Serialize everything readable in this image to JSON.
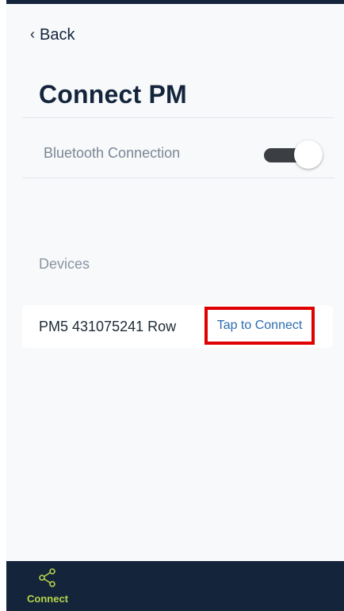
{
  "header": {
    "back_label": "Back",
    "title": "Connect PM"
  },
  "bluetooth": {
    "label": "Bluetooth Connection",
    "enabled": true
  },
  "devices": {
    "section_label": "Devices",
    "items": [
      {
        "name": "PM5 431075241 Row",
        "action_label": "Tap to Connect"
      }
    ]
  },
  "tabbar": {
    "tabs": [
      {
        "label": "Connect",
        "icon": "share-nodes-icon",
        "active": true
      }
    ]
  },
  "colors": {
    "navy": "#13243b",
    "accent_lime": "#b7d44a",
    "link_blue": "#2b6cb0",
    "highlight_red": "#e00000"
  }
}
